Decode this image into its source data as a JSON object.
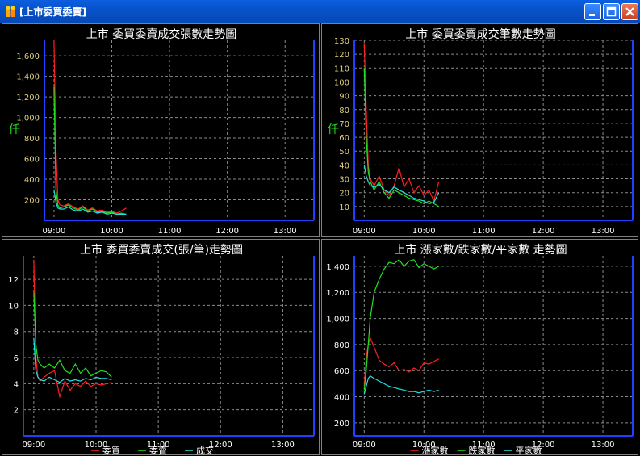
{
  "window": {
    "title": "[上市委買委賣]",
    "icons": {
      "app": "people-icon",
      "minimize": "minimize-icon",
      "maximize": "maximize-icon",
      "close": "close-icon"
    }
  },
  "chart_data": [
    {
      "type": "line",
      "title": "上市  委買委賣成交張數走勢圖",
      "ylabel": "仟",
      "x_ticks": [
        "09:00",
        "10:00",
        "11:00",
        "12:00",
        "13:00"
      ],
      "xlim": [
        "08:50",
        "13:30"
      ],
      "ylim": [
        0,
        1750
      ],
      "y_ticks": [
        200,
        400,
        600,
        800,
        "1,000",
        "1,200",
        "1,400",
        "1,600"
      ],
      "y_tick_values": [
        200,
        400,
        600,
        800,
        1000,
        1200,
        1400,
        1600
      ],
      "grid": true,
      "x": [
        "09:00",
        "09:02",
        "09:04",
        "09:06",
        "09:10",
        "09:15",
        "09:20",
        "09:25",
        "09:30",
        "09:35",
        "09:40",
        "09:45",
        "09:50",
        "09:55",
        "10:00",
        "10:05",
        "10:10",
        "10:15"
      ],
      "series": [
        {
          "color": "#ff2020",
          "values": [
            1750,
            700,
            200,
            150,
            140,
            160,
            130,
            110,
            140,
            100,
            120,
            90,
            100,
            80,
            90,
            70,
            90,
            120
          ]
        },
        {
          "color": "#20e020",
          "values": [
            1300,
            300,
            150,
            120,
            130,
            150,
            120,
            100,
            130,
            90,
            110,
            80,
            90,
            70,
            80,
            60,
            70,
            60
          ]
        },
        {
          "color": "#20e0e0",
          "values": [
            300,
            180,
            120,
            110,
            110,
            130,
            100,
            90,
            110,
            80,
            90,
            70,
            80,
            60,
            70,
            60,
            60,
            60
          ]
        }
      ]
    },
    {
      "type": "line",
      "title": "上市  委買委賣成交筆數走勢圖",
      "ylabel": "仟",
      "x_ticks": [
        "09:00",
        "10:00",
        "11:00",
        "12:00",
        "13:00"
      ],
      "xlim": [
        "08:50",
        "13:30"
      ],
      "ylim": [
        0,
        130
      ],
      "y_ticks": [
        10,
        20,
        30,
        40,
        50,
        60,
        70,
        80,
        90,
        100,
        110,
        120,
        130
      ],
      "y_tick_values": [
        10,
        20,
        30,
        40,
        50,
        60,
        70,
        80,
        90,
        100,
        110,
        120,
        130
      ],
      "grid": true,
      "x": [
        "09:00",
        "09:02",
        "09:04",
        "09:06",
        "09:10",
        "09:15",
        "09:20",
        "09:25",
        "09:30",
        "09:35",
        "09:40",
        "09:45",
        "09:50",
        "09:55",
        "10:00",
        "10:05",
        "10:10",
        "10:15"
      ],
      "series": [
        {
          "color": "#ff2020",
          "values": [
            128,
            80,
            40,
            30,
            25,
            32,
            22,
            18,
            25,
            38,
            24,
            30,
            20,
            25,
            18,
            22,
            14,
            28
          ]
        },
        {
          "color": "#20e020",
          "values": [
            110,
            60,
            35,
            28,
            22,
            28,
            20,
            16,
            22,
            20,
            18,
            16,
            15,
            14,
            12,
            14,
            12,
            10
          ]
        },
        {
          "color": "#20e0e0",
          "values": [
            40,
            32,
            28,
            25,
            24,
            26,
            22,
            20,
            24,
            22,
            20,
            18,
            16,
            15,
            14,
            12,
            13,
            20
          ]
        }
      ]
    },
    {
      "type": "line",
      "title": "上市  委買委賣成交(張/筆)走勢圖",
      "x_ticks": [
        "09:00",
        "10:00",
        "11:00",
        "12:00",
        "13:00"
      ],
      "xlim": [
        "08:50",
        "13:30"
      ],
      "ylim": [
        0,
        13.8
      ],
      "y_ticks": [
        2,
        4,
        6,
        8,
        10,
        12
      ],
      "y_tick_values": [
        2,
        4,
        6,
        8,
        10,
        12
      ],
      "grid": true,
      "legend": "bottom",
      "x": [
        "09:00",
        "09:02",
        "09:04",
        "09:06",
        "09:10",
        "09:15",
        "09:20",
        "09:25",
        "09:30",
        "09:35",
        "09:40",
        "09:45",
        "09:50",
        "09:55",
        "10:00",
        "10:05",
        "10:10",
        "10:15"
      ],
      "series": [
        {
          "name": "委買",
          "color": "#ff2020",
          "values": [
            13.5,
            6,
            4.5,
            4.2,
            4.5,
            4.8,
            5,
            3,
            4.2,
            3.5,
            4,
            3.8,
            4.2,
            3.8,
            4,
            3.9,
            4,
            4.1
          ]
        },
        {
          "name": "委賣",
          "color": "#20e020",
          "values": [
            11,
            7,
            5.8,
            5.5,
            5.2,
            5.5,
            5.2,
            5.8,
            5,
            4.8,
            5.5,
            4.8,
            5.2,
            4.6,
            4.8,
            5,
            4.9,
            4.5
          ]
        },
        {
          "name": "成交",
          "color": "#20e0e0",
          "values": [
            7.5,
            5,
            4.5,
            4.3,
            4.2,
            4.5,
            4.3,
            4.1,
            4.4,
            4.2,
            4.3,
            4.2,
            4.4,
            4.3,
            4.5,
            4.4,
            4.4,
            4.3
          ]
        }
      ]
    },
    {
      "type": "line",
      "title": "上市  漲家數/跌家數/平家數  走勢圖",
      "x_ticks": [
        "09:00",
        "10:00",
        "11:00",
        "12:00",
        "13:00"
      ],
      "xlim": [
        "08:50",
        "13:30"
      ],
      "ylim": [
        100,
        1480
      ],
      "y_ticks": [
        200,
        400,
        600,
        800,
        "1,000",
        "1,200",
        "1,400"
      ],
      "y_tick_values": [
        200,
        400,
        600,
        800,
        1000,
        1200,
        1400
      ],
      "grid": true,
      "legend": "bottom",
      "x": [
        "09:00",
        "09:02",
        "09:04",
        "09:06",
        "09:10",
        "09:15",
        "09:20",
        "09:25",
        "09:30",
        "09:35",
        "09:40",
        "09:45",
        "09:50",
        "09:55",
        "10:00",
        "10:05",
        "10:10",
        "10:15"
      ],
      "series": [
        {
          "name": "漲家數",
          "color": "#ff2020",
          "values": [
            480,
            700,
            800,
            850,
            780,
            680,
            650,
            630,
            660,
            600,
            610,
            590,
            620,
            600,
            660,
            650,
            670,
            690
          ]
        },
        {
          "name": "跌家數",
          "color": "#20e020",
          "values": [
            450,
            600,
            800,
            1000,
            1200,
            1300,
            1380,
            1430,
            1420,
            1450,
            1400,
            1440,
            1450,
            1390,
            1420,
            1400,
            1380,
            1400
          ]
        },
        {
          "name": "平家數",
          "color": "#20e0e0",
          "values": [
            420,
            480,
            540,
            560,
            540,
            520,
            500,
            480,
            470,
            460,
            450,
            440,
            440,
            430,
            440,
            450,
            440,
            450
          ]
        }
      ]
    }
  ]
}
